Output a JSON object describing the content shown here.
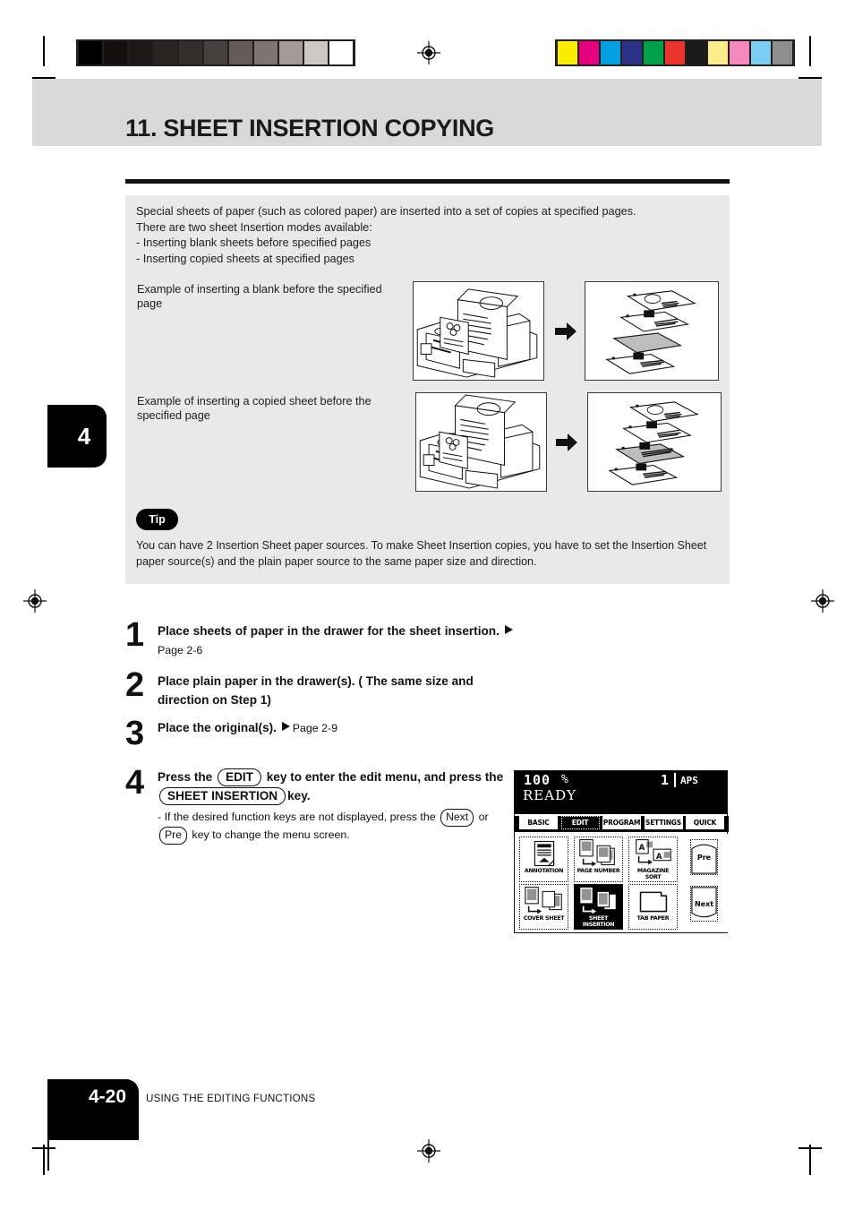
{
  "document": {
    "chapter_tab": "4",
    "title": "11. SHEET INSERTION COPYING",
    "footer_page": "4-20",
    "footer_section": "USING THE EDITING FUNCTIONS"
  },
  "intro": {
    "line1": "Special sheets of paper (such as colored paper) are inserted into a set of copies at specified pages.",
    "line2": "There are two sheet Insertion modes available:",
    "bullet1": "-  Inserting blank sheets before specified pages",
    "bullet2": "-  Inserting copied sheets at specified pages",
    "example1_caption": "Example of inserting a blank before the specified page",
    "example2_caption": "Example of inserting a copied sheet before the specified page"
  },
  "tip": {
    "badge": "Tip",
    "text": "You can have 2 Insertion Sheet paper sources. To make Sheet Insertion copies, you have to set the Insertion Sheet paper source(s) and the plain paper source to the same paper size and direction."
  },
  "steps": {
    "one": {
      "num": "1",
      "text": "Place sheets of paper in the drawer for the sheet insertion.",
      "page_ref": "Page 2-6"
    },
    "two": {
      "num": "2",
      "text": "Place plain paper in the drawer(s). ( The same size and direction on Step 1)"
    },
    "three": {
      "num": "3",
      "text": "Place the original(s).",
      "page_ref": "Page 2-9"
    },
    "four": {
      "num": "4",
      "text_a": "Press the",
      "key_edit": "EDIT",
      "text_b": "key to enter the edit menu, and press the",
      "key_sheet_insertion": "SHEET  INSERTION",
      "text_c": "key.",
      "note_a": "- If the desired function keys are not displayed, press the",
      "key_next": "Next",
      "note_b": "or",
      "key_pre": "Pre",
      "note_c": "key to change the menu screen."
    }
  },
  "lcd": {
    "zoom": "100",
    "percent": "%",
    "copy_count": "1",
    "paper_mode": "APS",
    "status": "READY",
    "tabs": [
      {
        "label": "BASIC",
        "selected": false
      },
      {
        "label": "EDIT",
        "selected": true
      },
      {
        "label": "PROGRAM",
        "selected": false
      },
      {
        "label": "SETTINGS",
        "selected": false
      },
      {
        "label": "QUICK",
        "selected": false
      }
    ],
    "function_keys": [
      {
        "label": "ANNOTATION",
        "selected": false
      },
      {
        "label": "PAGE NUMBER",
        "selected": false
      },
      {
        "label": "MAGAZINE SORT",
        "selected": false
      },
      {
        "label": "COVER SHEET",
        "selected": false
      },
      {
        "label_line1": "SHEET",
        "label_line2": "INSERTION",
        "selected": true
      },
      {
        "label": "TAB PAPER",
        "selected": false
      }
    ],
    "nav": {
      "prev": "Pre",
      "next": "Next"
    }
  },
  "calibration": {
    "grayscale": [
      "#010101",
      "#130f0f",
      "#1d1817",
      "#2a2423",
      "#342d2c",
      "#473f3e",
      "#645a58",
      "#7e7572",
      "#a39a96",
      "#cfc7c3",
      "#ffffff"
    ],
    "colors": [
      "#fced00",
      "#e5007d",
      "#00a0e3",
      "#2b3288",
      "#00a048",
      "#e8342b",
      "#1a1a1a",
      "#fbed8a",
      "#f488bd",
      "#7ccdf2",
      "#8d8d8d"
    ]
  }
}
